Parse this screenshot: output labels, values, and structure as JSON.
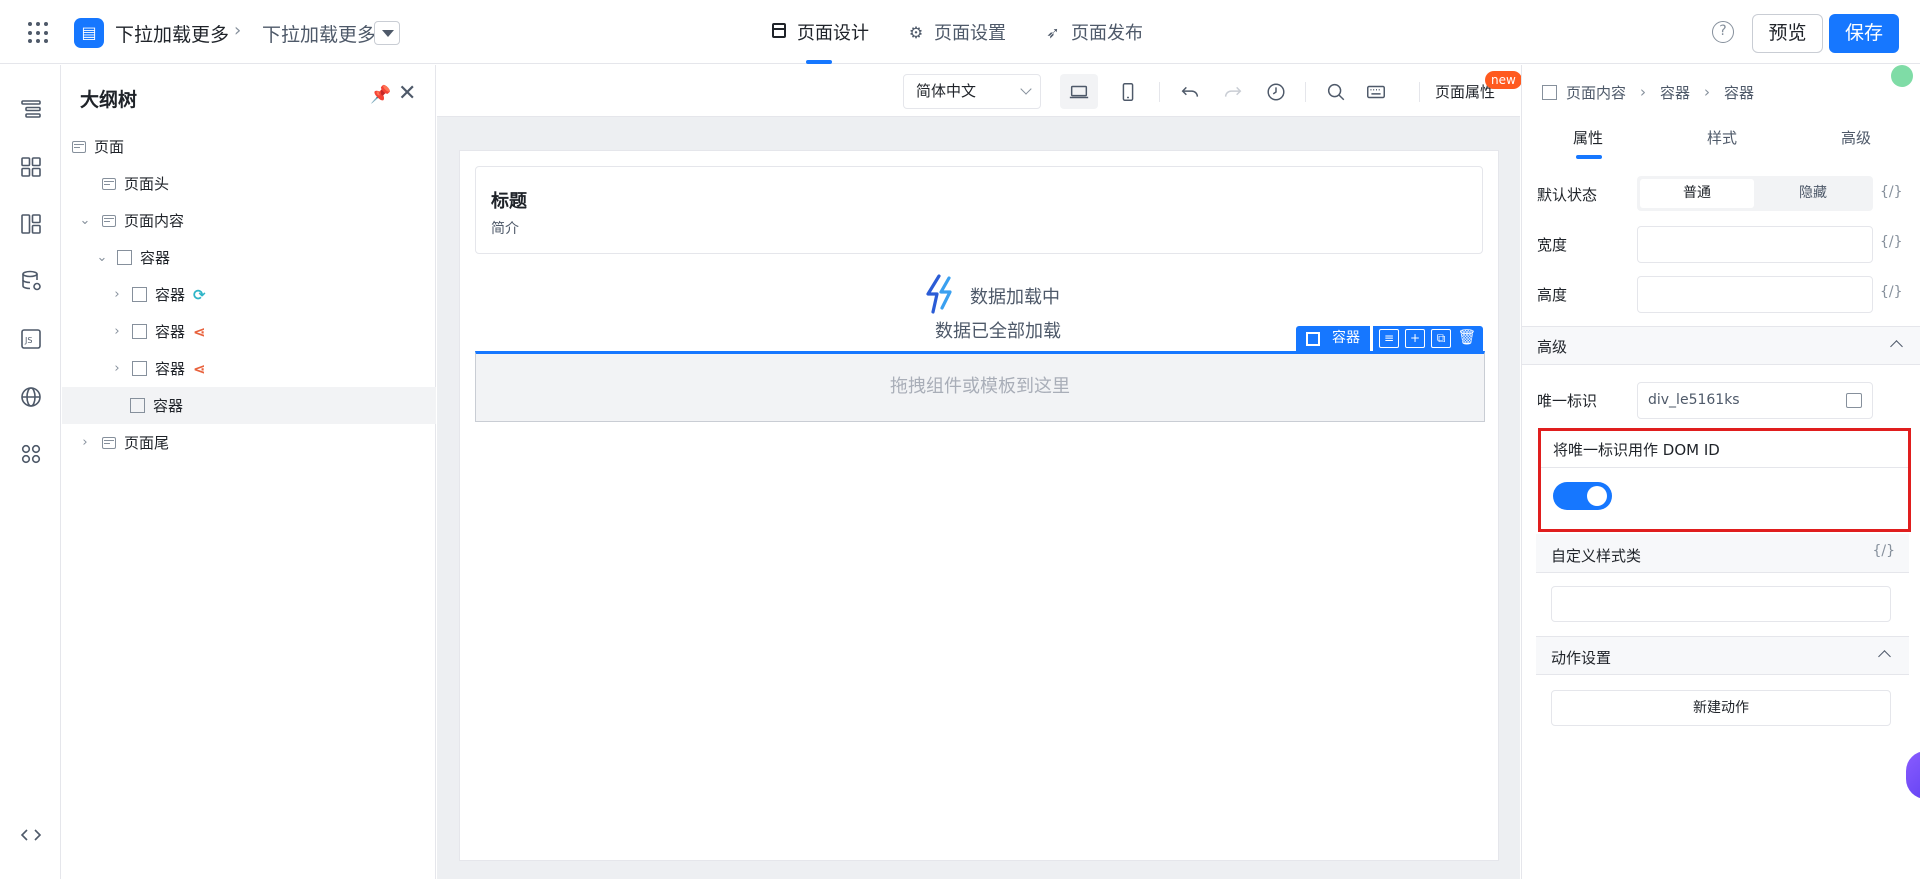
{
  "app": {
    "breadcrumb_app": "下拉加载更多",
    "breadcrumb_page": "下拉加载更多",
    "brand_color": "#1677ff"
  },
  "top_tabs": [
    {
      "label": "页面设计",
      "icon": "page-design-icon",
      "active": true
    },
    {
      "label": "页面设置",
      "icon": "gear-icon",
      "active": false
    },
    {
      "label": "页面发布",
      "icon": "send-icon",
      "active": false
    }
  ],
  "top_actions": {
    "preview_label": "预览",
    "save_label": "保存"
  },
  "rail_icons": [
    "outline-icon",
    "components-icon",
    "layout-icon",
    "datasource-icon",
    "js-icon",
    "globe-icon",
    "apps-icon",
    "code-icon"
  ],
  "outline": {
    "title": "大纲树",
    "nodes": [
      {
        "label": "页面",
        "level": 0,
        "type": "page"
      },
      {
        "label": "页面头",
        "level": 1,
        "type": "page"
      },
      {
        "label": "页面内容",
        "level": 1,
        "type": "page",
        "expanded": true
      },
      {
        "label": "容器",
        "level": 2,
        "type": "box",
        "expanded": true
      },
      {
        "label": "容器",
        "level": 3,
        "type": "box",
        "badge": "loop-icon"
      },
      {
        "label": "容器",
        "level": 3,
        "type": "box",
        "badge": "branch-icon"
      },
      {
        "label": "容器",
        "level": 3,
        "type": "box",
        "badge": "branch-icon"
      },
      {
        "label": "容器",
        "level": 3,
        "type": "box",
        "selected": true
      },
      {
        "label": "页面尾",
        "level": 1,
        "type": "page"
      }
    ]
  },
  "canvas": {
    "language": "简体中文",
    "page_props_label": "页面属性",
    "new_badge": "new",
    "card_title": "标题",
    "card_subtitle": "简介",
    "loading_text": "数据加载中",
    "loaded_text": "数据已全部加载",
    "selected_name": "容器",
    "drop_hint": "拖拽组件或模板到这里"
  },
  "props": {
    "breadcrumb": [
      "页面内容",
      "容器",
      "容器"
    ],
    "tabs": [
      {
        "label": "属性",
        "active": true
      },
      {
        "label": "样式",
        "active": false
      },
      {
        "label": "高级",
        "active": false
      }
    ],
    "default_state_label": "默认状态",
    "state_on": "普通",
    "state_off": "隐藏",
    "width_label": "宽度",
    "height_label": "高度",
    "expr_label": "{/}",
    "advanced_section": "高级",
    "unique_id_label": "唯一标识",
    "unique_id_value": "div_le5161ks",
    "dom_id_label": "将唯一标识用作 DOM ID",
    "dom_id_enabled": true,
    "custom_class_label": "自定义样式类",
    "action_section": "动作设置",
    "new_action_label": "新建动作"
  }
}
